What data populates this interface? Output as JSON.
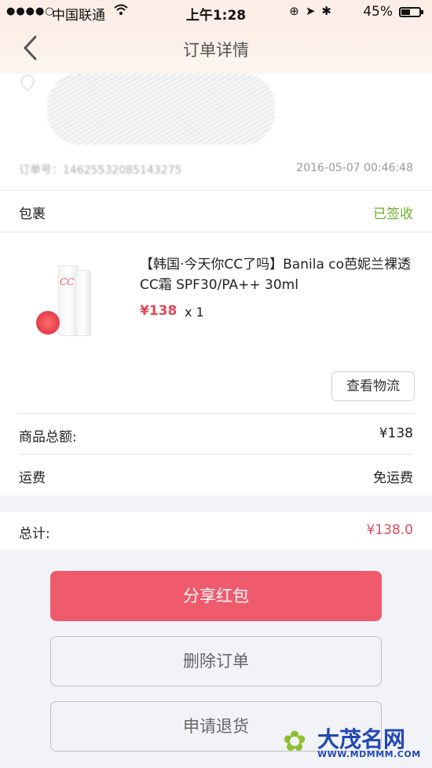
{
  "status_bar": {
    "signal": "●●●●○",
    "carrier": "中国联通",
    "time": "上午1:28",
    "battery_pct": "45%"
  },
  "nav": {
    "title": "订单详情",
    "back": "‹"
  },
  "order": {
    "number": "订单号：14625532085143275",
    "date": "2016-05-07 00:46:48"
  },
  "package": {
    "label": "包裹",
    "status": "已签收",
    "status_color": "#6fae2b"
  },
  "product": {
    "title": "【韩国·今天你CC了吗】Banila co芭妮兰裸透CC霜 SPF30/PA++ 30ml",
    "price": "¥138",
    "quantity": "x 1",
    "image_text": "CC",
    "logistics_button": "查看物流"
  },
  "summary": {
    "subtotal_label": "商品总额:",
    "subtotal_value": "¥138",
    "shipping_label": "运费",
    "shipping_value": "免运费",
    "total_label": "总计:",
    "total_value": "¥138.0"
  },
  "actions": {
    "share": "分享红包",
    "delete": "删除订单",
    "refund": "申请退货"
  },
  "watermark": {
    "name": "大茂名网",
    "url": "WWW.MDMMM.COM"
  },
  "colors": {
    "accent": "#ef5a6c",
    "price": "#e0485a",
    "success": "#6fae2b"
  }
}
